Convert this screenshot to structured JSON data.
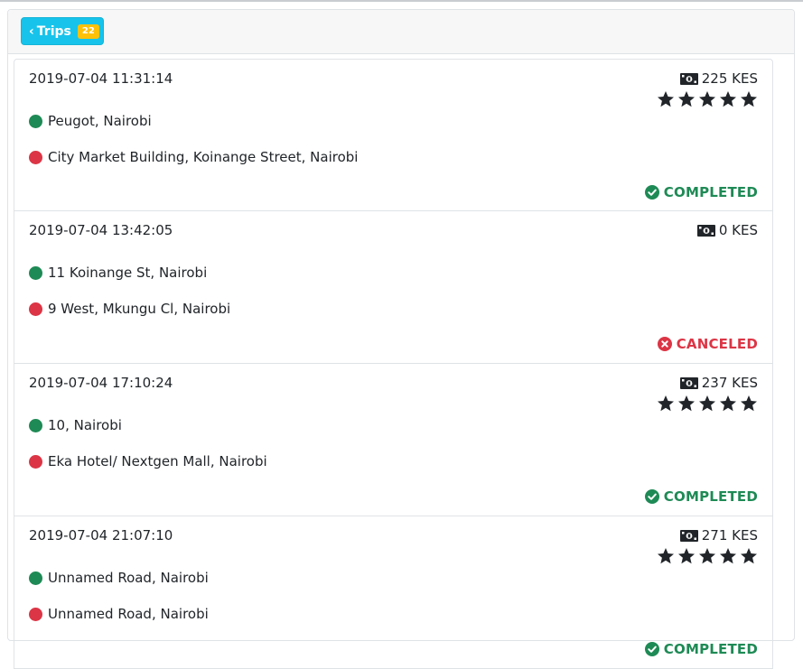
{
  "header": {
    "trips_button_label": "Trips",
    "trips_count": "22"
  },
  "colors": {
    "accent": "#17c3ea",
    "badge": "#ffc107",
    "completed": "#1e8a55",
    "canceled": "#dc3545"
  },
  "trips": [
    {
      "datetime": "2019-07-04 11:31:14",
      "fare": "225 KES",
      "rating": 5,
      "pickup": "Peugot, Nairobi",
      "dropoff": "City Market Building, Koinange Street, Nairobi",
      "status": "COMPLETED"
    },
    {
      "datetime": "2019-07-04 13:42:05",
      "fare": "0 KES",
      "rating": 0,
      "pickup": "11 Koinange St, Nairobi",
      "dropoff": "9 West, Mkungu Cl, Nairobi",
      "status": "CANCELED"
    },
    {
      "datetime": "2019-07-04 17:10:24",
      "fare": "237 KES",
      "rating": 5,
      "pickup": "10, Nairobi",
      "dropoff": "Eka Hotel/ Nextgen Mall, Nairobi",
      "status": "COMPLETED"
    },
    {
      "datetime": "2019-07-04 21:07:10",
      "fare": "271 KES",
      "rating": 5,
      "pickup": "Unnamed Road, Nairobi",
      "dropoff": "Unnamed Road, Nairobi",
      "status": "COMPLETED"
    }
  ]
}
